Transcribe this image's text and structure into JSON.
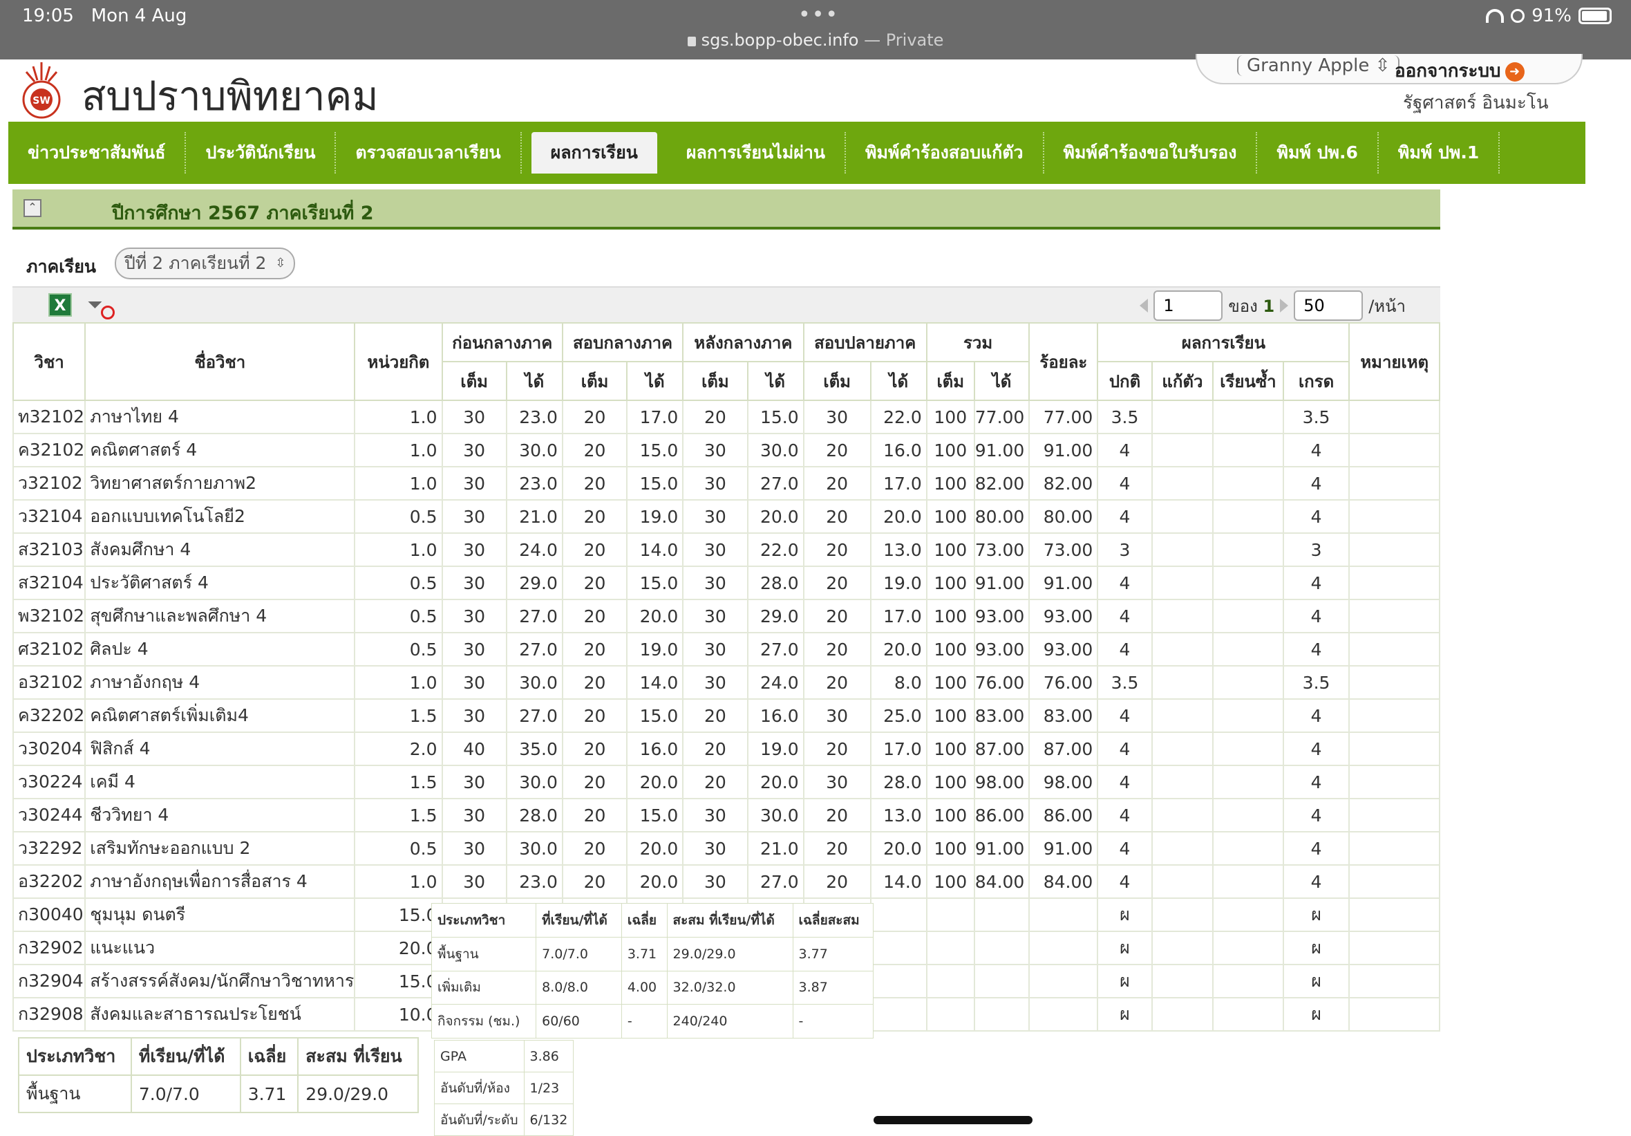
{
  "statusbar": {
    "time": "19:05",
    "date": "Mon 4 Aug",
    "url": "sgs.bopp-obec.info",
    "private": " — Private",
    "battery": "91%"
  },
  "site": {
    "title": "สบปราบพิทยาคม"
  },
  "user": {
    "theme": "Granny Apple",
    "logout": "ออกจากระบบ",
    "name": "รัฐศาสตร์ อินมะโน"
  },
  "nav": [
    "ข่าวประชาสัมพันธ์",
    "ประวัตินักเรียน",
    "ตรวจสอบเวลาเรียน",
    "ผลการเรียน",
    "ผลการเรียนไม่ผ่าน",
    "พิมพ์คำร้องสอบแก้ตัว",
    "พิมพ์คำร้องขอใบรับรอง",
    "พิมพ์ ปพ.6",
    "พิมพ์ ปพ.1"
  ],
  "panel": {
    "title": "ปีการศึกษา 2567 ภาคเรียนที่ 2"
  },
  "term": {
    "label": "ภาคเรียน",
    "selected": "ปีที่ 2 ภาคเรียนที่ 2"
  },
  "pager": {
    "page": "1",
    "of_label": "ของ",
    "total": "1",
    "per_page": "50",
    "per_page_label": "/หน้า"
  },
  "table": {
    "headers": {
      "code": "วิชา",
      "name": "ชื่อวิชา",
      "credit": "หน่วยกิต",
      "g1": "ก่อนกลางภาค",
      "g2": "สอบกลางภาค",
      "g3": "หลังกลางภาค",
      "g4": "สอบปลายภาค",
      "g5": "รวม",
      "percent": "ร้อยละ",
      "result": "ผลการเรียน",
      "note": "หมายเหตุ",
      "full": "เต็ม",
      "got": "ได้",
      "normal": "ปกติ",
      "remedial": "แก้ตัว",
      "repeat": "เรียนซ้ำ",
      "grade": "เกรด"
    },
    "rows": [
      [
        "ท32102",
        "ภาษาไทย 4",
        "1.0",
        "30",
        "23.0",
        "20",
        "17.0",
        "20",
        "15.0",
        "30",
        "22.0",
        "100",
        "77.00",
        "77.00",
        "3.5",
        "",
        "",
        "3.5"
      ],
      [
        "ค32102",
        "คณิตศาสตร์ 4",
        "1.0",
        "30",
        "30.0",
        "20",
        "15.0",
        "30",
        "30.0",
        "20",
        "16.0",
        "100",
        "91.00",
        "91.00",
        "4",
        "",
        "",
        "4"
      ],
      [
        "ว32102",
        "วิทยาศาสตร์กายภาพ2",
        "1.0",
        "30",
        "23.0",
        "20",
        "15.0",
        "30",
        "27.0",
        "20",
        "17.0",
        "100",
        "82.00",
        "82.00",
        "4",
        "",
        "",
        "4"
      ],
      [
        "ว32104",
        "ออกแบบเทคโนโลยี2",
        "0.5",
        "30",
        "21.0",
        "20",
        "19.0",
        "30",
        "20.0",
        "20",
        "20.0",
        "100",
        "80.00",
        "80.00",
        "4",
        "",
        "",
        "4"
      ],
      [
        "ส32103",
        "สังคมศึกษา 4",
        "1.0",
        "30",
        "24.0",
        "20",
        "14.0",
        "30",
        "22.0",
        "20",
        "13.0",
        "100",
        "73.00",
        "73.00",
        "3",
        "",
        "",
        "3"
      ],
      [
        "ส32104",
        "ประวัติศาสตร์ 4",
        "0.5",
        "30",
        "29.0",
        "20",
        "15.0",
        "30",
        "28.0",
        "20",
        "19.0",
        "100",
        "91.00",
        "91.00",
        "4",
        "",
        "",
        "4"
      ],
      [
        "พ32102",
        "สุขศึกษาและพลศึกษา 4",
        "0.5",
        "30",
        "27.0",
        "20",
        "20.0",
        "30",
        "29.0",
        "20",
        "17.0",
        "100",
        "93.00",
        "93.00",
        "4",
        "",
        "",
        "4"
      ],
      [
        "ศ32102",
        "ศิลปะ 4",
        "0.5",
        "30",
        "27.0",
        "20",
        "19.0",
        "30",
        "27.0",
        "20",
        "20.0",
        "100",
        "93.00",
        "93.00",
        "4",
        "",
        "",
        "4"
      ],
      [
        "อ32102",
        "ภาษาอังกฤษ 4",
        "1.0",
        "30",
        "30.0",
        "20",
        "14.0",
        "30",
        "24.0",
        "20",
        "8.0",
        "100",
        "76.00",
        "76.00",
        "3.5",
        "",
        "",
        "3.5"
      ],
      [
        "ค32202",
        "คณิตศาสตร์เพิ่มเติม4",
        "1.5",
        "30",
        "27.0",
        "20",
        "15.0",
        "20",
        "16.0",
        "30",
        "25.0",
        "100",
        "83.00",
        "83.00",
        "4",
        "",
        "",
        "4"
      ],
      [
        "ว30204",
        "ฟิสิกส์ 4",
        "2.0",
        "40",
        "35.0",
        "20",
        "16.0",
        "20",
        "19.0",
        "20",
        "17.0",
        "100",
        "87.00",
        "87.00",
        "4",
        "",
        "",
        "4"
      ],
      [
        "ว30224",
        "เคมี 4",
        "1.5",
        "30",
        "30.0",
        "20",
        "20.0",
        "20",
        "20.0",
        "30",
        "28.0",
        "100",
        "98.00",
        "98.00",
        "4",
        "",
        "",
        "4"
      ],
      [
        "ว30244",
        "ชีววิทยา 4",
        "1.5",
        "30",
        "28.0",
        "20",
        "15.0",
        "30",
        "30.0",
        "20",
        "13.0",
        "100",
        "86.00",
        "86.00",
        "4",
        "",
        "",
        "4"
      ],
      [
        "ว32292",
        "เสริมทักษะออกแบบ 2",
        "0.5",
        "30",
        "30.0",
        "20",
        "20.0",
        "30",
        "21.0",
        "20",
        "20.0",
        "100",
        "91.00",
        "91.00",
        "4",
        "",
        "",
        "4"
      ],
      [
        "อ32202",
        "ภาษาอังกฤษเพื่อการสื่อสาร 4",
        "1.0",
        "30",
        "23.0",
        "20",
        "20.0",
        "30",
        "27.0",
        "20",
        "14.0",
        "100",
        "84.00",
        "84.00",
        "4",
        "",
        "",
        "4"
      ],
      [
        "ก30040",
        "ชุมนุม ดนตรี",
        "15.0",
        "",
        "",
        "",
        "",
        "",
        "",
        "",
        "",
        "",
        "",
        "",
        "ผ",
        "",
        "",
        "ผ"
      ],
      [
        "ก32902",
        "แนะแนว",
        "20.0",
        "",
        "",
        "",
        "",
        "",
        "",
        "",
        "",
        "",
        "",
        "",
        "ผ",
        "",
        "",
        "ผ"
      ],
      [
        "ก32904",
        "สร้างสรรค์สังคม/นักศึกษาวิชาทหาร",
        "15.0",
        "",
        "",
        "",
        "",
        "",
        "",
        "",
        "",
        "",
        "",
        "",
        "ผ",
        "",
        "",
        "ผ"
      ],
      [
        "ก32908",
        "สังคมและสาธารณประโยชน์",
        "10.0",
        "",
        "",
        "",
        "",
        "",
        "",
        "",
        "",
        "",
        "",
        "",
        "ผ",
        "",
        "",
        "ผ"
      ]
    ]
  },
  "summary_mid": {
    "headers": [
      "ประเภทวิชา",
      "ที่เรียน/ที่ได้",
      "เฉลี่ย",
      "สะสม ที่เรียน/ที่ได้",
      "เฉลี่ยสะสม"
    ],
    "rows": [
      [
        "พื้นฐาน",
        "7.0/7.0",
        "3.71",
        "29.0/29.0",
        "3.77"
      ],
      [
        "เพิ่มเติม",
        "8.0/8.0",
        "4.00",
        "32.0/32.0",
        "3.87"
      ],
      [
        "กิจกรรม (ชม.)",
        "60/60",
        "-",
        "240/240",
        "-"
      ]
    ]
  },
  "gpa": [
    [
      "GPA",
      "3.86"
    ],
    [
      "อันดับที่/ห้อง",
      "1/23"
    ],
    [
      "อันดับที่/ระดับ",
      "6/132"
    ]
  ],
  "summary_left": {
    "headers": [
      "ประเภทวิชา",
      "ที่เรียน/ที่ได้",
      "เฉลี่ย",
      "สะสม ที่เรียน"
    ],
    "rows": [
      [
        "พื้นฐาน",
        "7.0/7.0",
        "3.71",
        "29.0/29.0"
      ]
    ]
  }
}
